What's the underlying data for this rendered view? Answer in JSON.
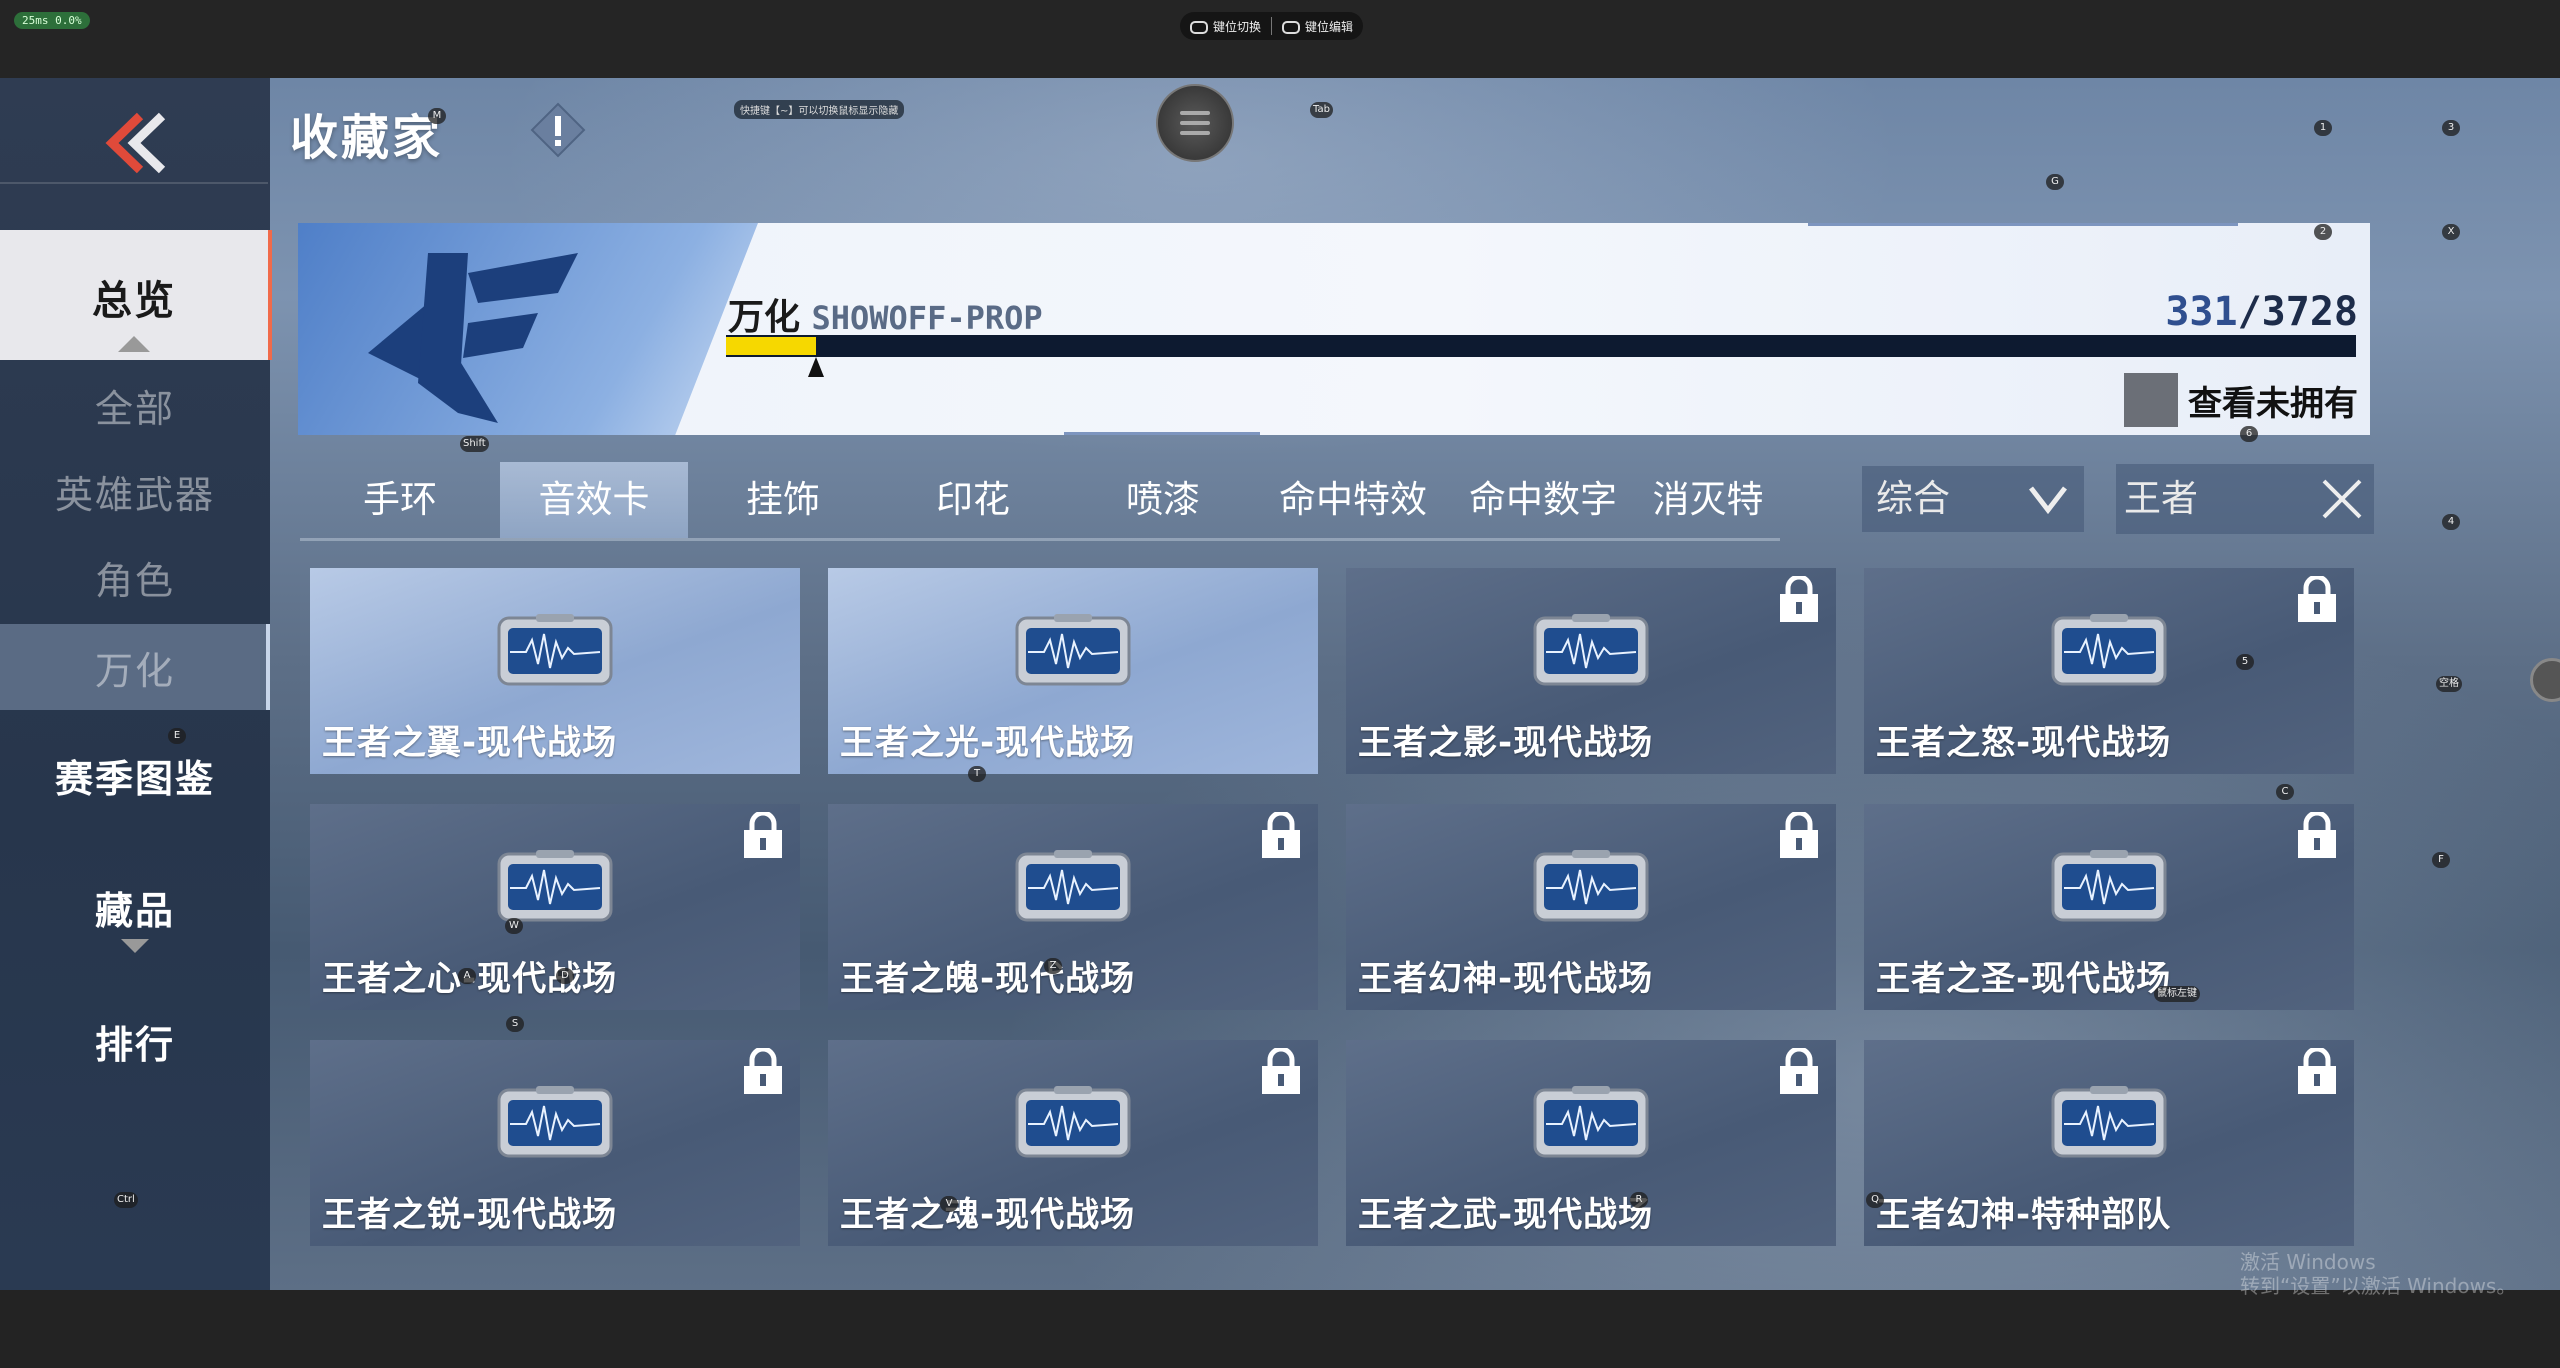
{
  "topbar": {
    "fps": "25ms 0.0%",
    "switch_label": "键位切换",
    "edit_label": "键位编辑"
  },
  "sidebar": {
    "items": [
      "总览",
      "全部",
      "英雄武器",
      "角色",
      "万化",
      "赛季图鉴",
      "藏品",
      "排行"
    ]
  },
  "header": {
    "title": "收藏家",
    "hint": "快捷键【~】可以切换鼠标显示隐藏"
  },
  "keys": {
    "title": "M",
    "tab": "Tab",
    "g": "G",
    "k1": "1",
    "k3": "3",
    "k2": "2",
    "x": "X",
    "shift": "Shift",
    "six": "6",
    "four": "4",
    "e": "E",
    "t": "T",
    "five": "5",
    "c": "C",
    "f": "F",
    "w": "W",
    "a": "A",
    "d": "D",
    "z": "Z",
    "s": "S",
    "space": "空格",
    "ctrl": "Ctrl",
    "v": "V",
    "r": "R",
    "q": "Q",
    "mid": "鼠标左键"
  },
  "banner": {
    "label_cn": "万化",
    "label_en": "SHOWOFF-PROP",
    "owned": "331",
    "total": "/3728",
    "progress": 0.055,
    "view_unowned": "查看未拥有"
  },
  "tabs": [
    "手环",
    "音效卡",
    "挂饰",
    "印花",
    "喷漆",
    "命中特效",
    "命中数字",
    "消灭特"
  ],
  "filter": {
    "sort_label": "综合",
    "search_value": "王者"
  },
  "cards": [
    {
      "name": "王者之翼-现代战场",
      "owned": true
    },
    {
      "name": "王者之光-现代战场",
      "owned": true
    },
    {
      "name": "王者之影-现代战场",
      "owned": false
    },
    {
      "name": "王者之怒-现代战场",
      "owned": false
    },
    {
      "name": "王者之心-现代战场",
      "owned": false
    },
    {
      "name": "王者之魄-现代战场",
      "owned": false
    },
    {
      "name": "王者幻神-现代战场",
      "owned": false
    },
    {
      "name": "王者之圣-现代战场",
      "owned": false
    },
    {
      "name": "王者之锐-现代战场",
      "owned": false
    },
    {
      "name": "王者之魂-现代战场",
      "owned": false
    },
    {
      "name": "王者之武-现代战场",
      "owned": false
    },
    {
      "name": "王者幻神-特种部队",
      "owned": false
    }
  ],
  "watermark": {
    "line1": "激活 Windows",
    "line2": "转到“设置”以激活 Windows。"
  },
  "colors": {
    "accent": "#f06a4a",
    "progress_fill": "#f6d800",
    "progress_track": "#0d1a30"
  }
}
